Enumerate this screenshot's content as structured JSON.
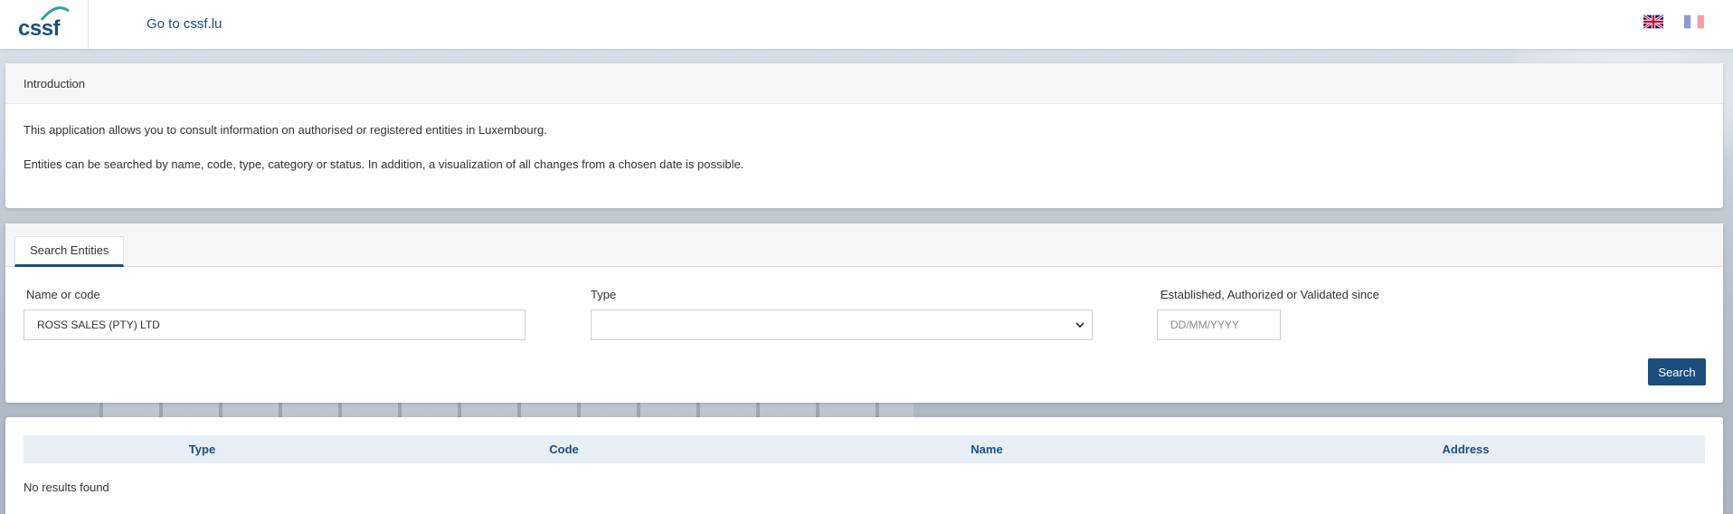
{
  "header": {
    "logo_text": "cssf",
    "goto_link": "Go to cssf.lu",
    "languages": [
      {
        "code": "en",
        "icon": "uk-flag-icon",
        "active": true
      },
      {
        "code": "fr",
        "icon": "france-flag-icon",
        "active": false
      }
    ]
  },
  "intro": {
    "title": "Introduction",
    "paragraphs": [
      "This application allows you to consult information on authorised or registered entities in Luxembourg.",
      "Entities can be searched by name, code, type, category or status. In addition, a visualization of all changes from a chosen date is possible."
    ]
  },
  "search": {
    "tab_label": "Search Entities",
    "name_label": "Name or code",
    "name_value": "ROSS SALES (PTY) LTD",
    "type_label": "Type",
    "type_value": "",
    "date_label": "Established, Authorized or Validated since",
    "date_placeholder": "DD/MM/YYYY",
    "search_button": "Search"
  },
  "results": {
    "columns": [
      "Type",
      "Code",
      "Name",
      "Address"
    ],
    "empty_message": "No results found"
  },
  "colors": {
    "brand": "#1b4e7c",
    "table_header_bg": "#e8eef6"
  }
}
